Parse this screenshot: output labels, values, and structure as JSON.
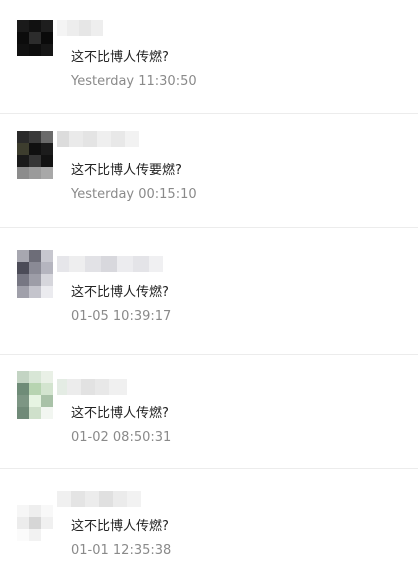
{
  "messages": [
    {
      "text": "这不比博人传燃?",
      "time": "Yesterday 11:30:50"
    },
    {
      "text": "这不比博人传要燃?",
      "time": "Yesterday 00:15:10"
    },
    {
      "text": "这不比博人传燃?",
      "time": "01-05 10:39:17"
    },
    {
      "text": "这不比博人传燃?",
      "time": "01-02 08:50:31"
    },
    {
      "text": "这不比博人传燃?",
      "time": "01-01 12:35:38"
    }
  ]
}
